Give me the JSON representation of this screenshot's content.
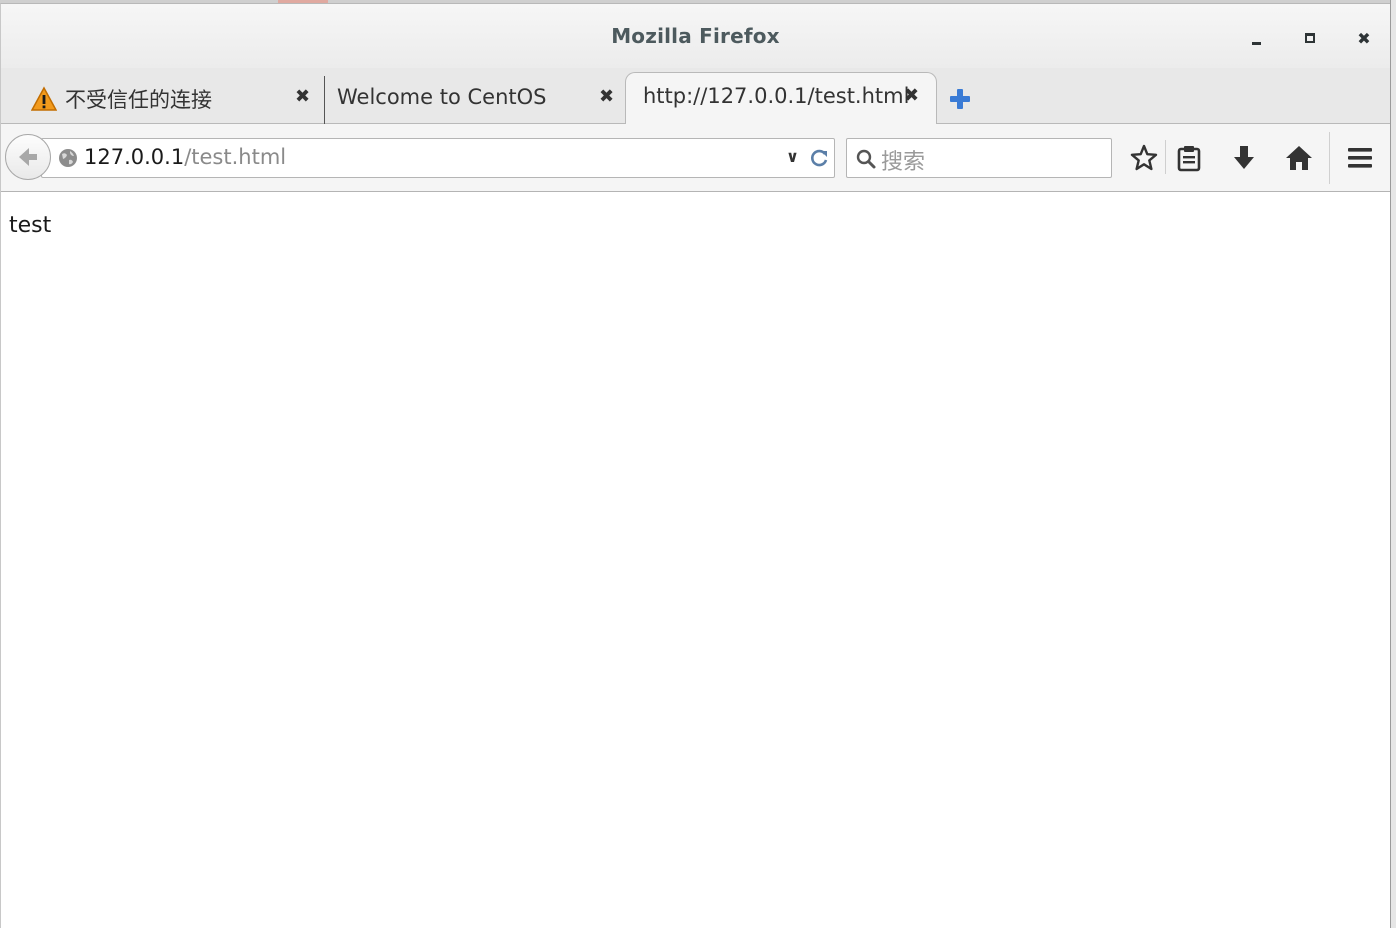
{
  "window": {
    "title": "Mozilla Firefox",
    "controls": [
      "minimize-icon",
      "maximize-icon",
      "close-icon"
    ]
  },
  "tabs": [
    {
      "label": "不受信任的连接",
      "icon": "warning-icon",
      "active": false
    },
    {
      "label": "Welcome to CentOS",
      "active": false
    },
    {
      "label": "http://127.0.0.1/test.html",
      "active": true
    }
  ],
  "tab_close_glyph": "✖",
  "navbar": {
    "url_host": "127.0.0.1",
    "url_path": "/test.html",
    "search_placeholder": "搜索"
  },
  "content": {
    "body_text": "test"
  },
  "colors": {
    "new_tab_accent": "#3a7bd5",
    "warning": "#f29a1c"
  }
}
